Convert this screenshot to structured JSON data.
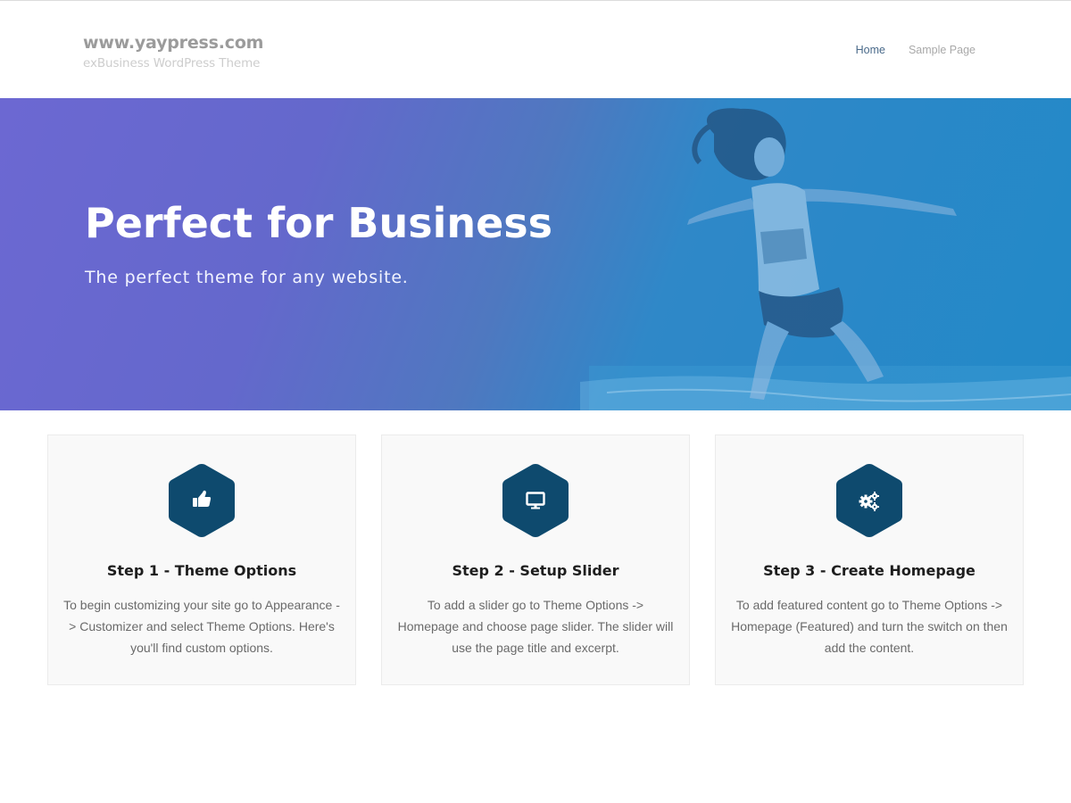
{
  "site": {
    "title": "www.yaypress.com",
    "description": "exBusiness WordPress Theme"
  },
  "nav": {
    "items": [
      {
        "label": "Home",
        "active": true
      },
      {
        "label": "Sample Page",
        "active": false
      }
    ]
  },
  "hero": {
    "title": "Perfect for Business",
    "subtitle": "The perfect theme for any website."
  },
  "features": [
    {
      "icon": "thumbs-up-icon",
      "title": "Step 1 - Theme Options",
      "text": "To begin customizing your site go to Appearance -> Customizer and select Theme Options. Here's you'll find custom options."
    },
    {
      "icon": "desktop-monitor-icon",
      "title": "Step 2 - Setup Slider",
      "text": "To add a slider go to Theme Options -> Homepage and choose page slider. The slider will use the page title and excerpt."
    },
    {
      "icon": "gears-icon",
      "title": "Step 3 - Create Homepage",
      "text": "To add featured content go to Theme Options -> Homepage (Featured) and turn the switch on then add the content."
    }
  ],
  "colors": {
    "hex_icon_bg": "#0e4a6e",
    "hero_gradient_start": "#6c68d2",
    "hero_gradient_end": "#2289c8",
    "nav_active": "#4a6a8a",
    "nav_inactive": "#a9a9a9"
  }
}
